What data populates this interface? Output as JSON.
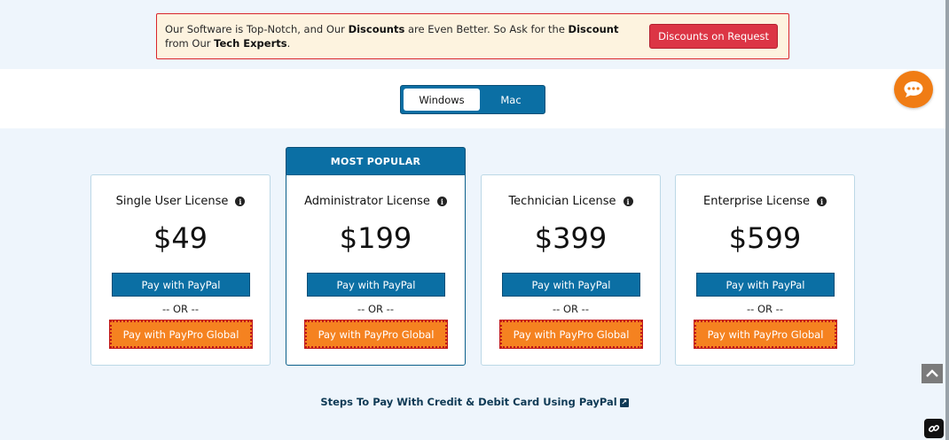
{
  "promo": {
    "text_1": "Our Software is Top-Notch, and Our ",
    "bold_1": "Discounts",
    "text_2": " are Even Better. So Ask for the ",
    "bold_2": "Discount",
    "text_3": "from Our ",
    "bold_3": "Tech Experts",
    "text_4": ".",
    "button_label": "Discounts on Request"
  },
  "os_toggle": {
    "windows_label": "Windows",
    "mac_label": "Mac",
    "selected": "Windows"
  },
  "popular_label": "MOST POPULAR",
  "plans": [
    {
      "title": "Single User License",
      "price": "$49",
      "paypal_label": "Pay with PayPal",
      "or_label": "-- OR --",
      "paypro_label": "Pay with PayPro Global"
    },
    {
      "title": "Administrator License",
      "price": "$199",
      "paypal_label": "Pay with PayPal",
      "or_label": "-- OR --",
      "paypro_label": "Pay with PayPro Global"
    },
    {
      "title": "Technician License",
      "price": "$399",
      "paypal_label": "Pay with PayPal",
      "or_label": "-- OR --",
      "paypro_label": "Pay with PayPro Global"
    },
    {
      "title": "Enterprise License",
      "price": "$599",
      "paypal_label": "Pay with PayPal",
      "or_label": "-- OR --",
      "paypro_label": "Pay with PayPro Global"
    }
  ],
  "steps_link": "Steps To Pay With Credit & Debit Card Using PayPal",
  "icons": {
    "info": "info-icon",
    "chat": "chat-bubble-icon",
    "external": "external-link-icon",
    "scroll_top": "chevron-up-icon",
    "corner": "link-icon"
  },
  "colors": {
    "primary_blue": "#0b6fa4",
    "orange": "#f58220",
    "alert_red": "#dc3545",
    "promo_bg": "#fdf3df",
    "page_bg": "#eef5fc"
  }
}
